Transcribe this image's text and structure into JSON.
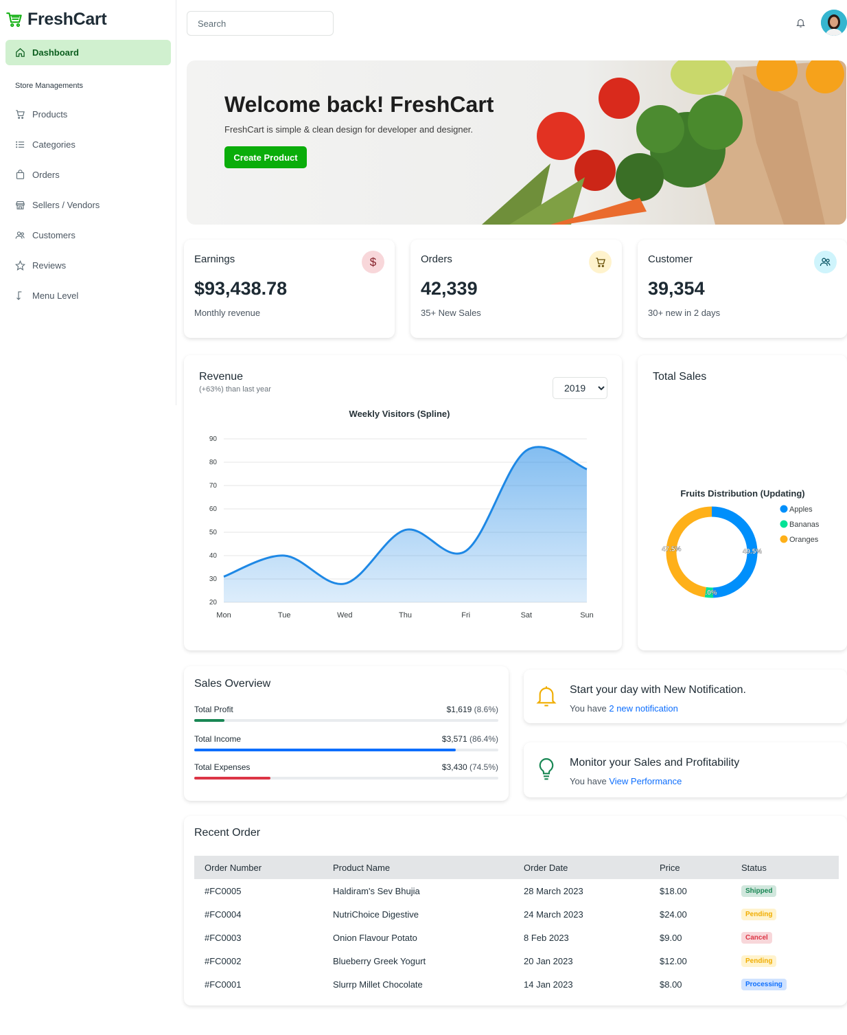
{
  "app": {
    "name": "FreshCart"
  },
  "sidebar": {
    "active_item": "Dashboard",
    "section_label": "Store Managements",
    "items": [
      {
        "label": "Products",
        "icon": "cart-icon"
      },
      {
        "label": "Categories",
        "icon": "list-icon"
      },
      {
        "label": "Orders",
        "icon": "bag-icon"
      },
      {
        "label": "Sellers / Vendors",
        "icon": "store-icon"
      },
      {
        "label": "Customers",
        "icon": "users-icon"
      },
      {
        "label": "Reviews",
        "icon": "star-icon"
      },
      {
        "label": "Menu Level",
        "icon": "arrow-icon"
      }
    ]
  },
  "topbar": {
    "search_placeholder": "Search"
  },
  "hero": {
    "title": "Welcome back! FreshCart",
    "subtitle": "FreshCart is simple & clean design for developer and designer.",
    "button": "Create Product"
  },
  "stats": [
    {
      "label": "Earnings",
      "value": "$93,438.78",
      "sub": "Monthly revenue",
      "icon": "dollar-icon",
      "icon_bg": "#f8d7da",
      "icon_color": "#842029"
    },
    {
      "label": "Orders",
      "value": "42,339",
      "sub": "35+ New Sales",
      "icon": "cart-icon",
      "icon_bg": "#fff3cd",
      "icon_color": "#664d03"
    },
    {
      "label": "Customer",
      "value": "39,354",
      "sub": "30+ new in 2 days",
      "icon": "users-icon",
      "icon_bg": "#cff4fc",
      "icon_color": "#055160"
    }
  ],
  "revenue": {
    "title": "Revenue",
    "subtitle": "(+63%) than last year",
    "year": "2019",
    "year_options": [
      "2019"
    ]
  },
  "chart_data": [
    {
      "type": "area",
      "title": "Weekly Visitors (Spline)",
      "categories": [
        "Mon",
        "Tue",
        "Wed",
        "Thu",
        "Fri",
        "Sat",
        "Sun"
      ],
      "series": [
        {
          "values": [
            31,
            40,
            28,
            51,
            42,
            85,
            77
          ]
        }
      ],
      "ylim": [
        20,
        90
      ],
      "yticks": [
        20,
        30,
        40,
        50,
        60,
        70,
        80,
        90
      ],
      "grid": true,
      "color": "#1e88e5"
    },
    {
      "type": "pie",
      "title": "Fruits Distribution (Updating)",
      "labels": [
        "Apples",
        "Bananas",
        "Oranges"
      ],
      "values": [
        49.5,
        3.0,
        47.5
      ],
      "value_labels": [
        "49.5%",
        "3.0%",
        "47.5%"
      ],
      "colors": [
        "#008ffb",
        "#00e396",
        "#feb019"
      ],
      "legend": "right"
    }
  ],
  "total_sales": {
    "title": "Total Sales"
  },
  "sales_overview": {
    "title": "Sales Overview",
    "rows": [
      {
        "label": "Total Profit",
        "amount": "$1,619",
        "pct": "(8.6%)",
        "fill": 0.1,
        "color": "#198754"
      },
      {
        "label": "Total Income",
        "amount": "$3,571",
        "pct": "(86.4%)",
        "fill": 0.86,
        "color": "#0d6efd"
      },
      {
        "label": "Total Expenses",
        "amount": "$3,430",
        "pct": "(74.5%)",
        "fill": 0.25,
        "color": "#dc3545"
      }
    ]
  },
  "notifications": [
    {
      "title": "Start your day with New Notification.",
      "prefix": "You have ",
      "link": "2 new notification",
      "icon": "bell-icon"
    },
    {
      "title": "Monitor your Sales and Profitability",
      "prefix": "You have ",
      "link": "View Performance",
      "icon": "lightbulb-icon"
    }
  ],
  "recent_orders": {
    "title": "Recent Order",
    "columns": [
      "Order Number",
      "Product Name",
      "Order Date",
      "Price",
      "Status"
    ],
    "rows": [
      {
        "order": "#FC0005",
        "product": "Haldiram's Sev Bhujia",
        "date": "28 March 2023",
        "price": "$18.00",
        "status": "Shipped"
      },
      {
        "order": "#FC0004",
        "product": "NutriChoice Digestive",
        "date": "24 March 2023",
        "price": "$24.00",
        "status": "Pending"
      },
      {
        "order": "#FC0003",
        "product": "Onion Flavour Potato",
        "date": "8 Feb 2023",
        "price": "$9.00",
        "status": "Cancel"
      },
      {
        "order": "#FC0002",
        "product": "Blueberry Greek Yogurt",
        "date": "20 Jan 2023",
        "price": "$12.00",
        "status": "Pending"
      },
      {
        "order": "#FC0001",
        "product": "Slurrp Millet Chocolate",
        "date": "14 Jan 2023",
        "price": "$8.00",
        "status": "Processing"
      }
    ],
    "status_styles": {
      "Shipped": {
        "bg": "#d1e7dd",
        "fg": "#198754"
      },
      "Pending": {
        "bg": "#fff3cd",
        "fg": "#f0ad00"
      },
      "Cancel": {
        "bg": "#f8d7da",
        "fg": "#dc3545"
      },
      "Processing": {
        "bg": "#cfe2ff",
        "fg": "#0d6efd"
      }
    }
  }
}
